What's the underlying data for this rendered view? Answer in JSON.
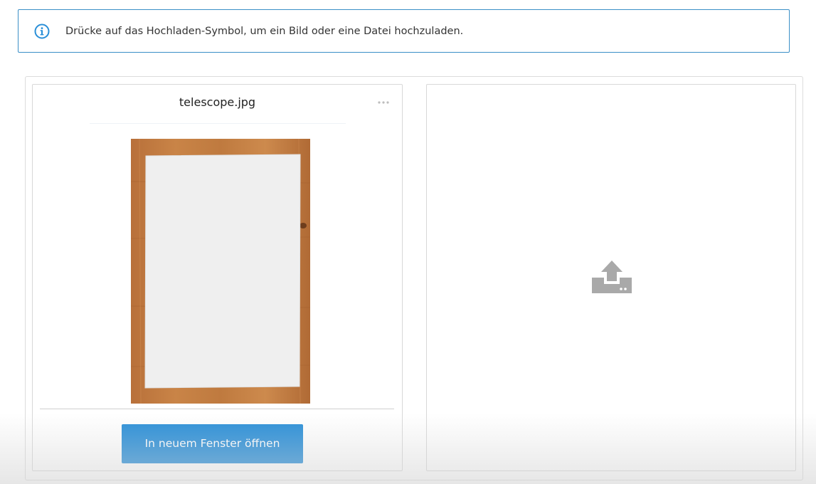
{
  "info_banner": {
    "icon": "info-circle-icon",
    "message": "Drücke auf das Hochladen-Symbol, um ein Bild oder eine Datei hochzuladen.",
    "border_color": "#3a8fc7"
  },
  "file_card": {
    "file_name": "telescope.jpg",
    "menu_icon": "more-dots-icon",
    "preview_description": "blank-paper-on-wooden-table",
    "open_button_label": "In neuem Fenster öffnen",
    "button_color": "#2a8fd8"
  },
  "upload_card": {
    "icon": "upload-icon",
    "icon_color": "#a9a9a9"
  }
}
